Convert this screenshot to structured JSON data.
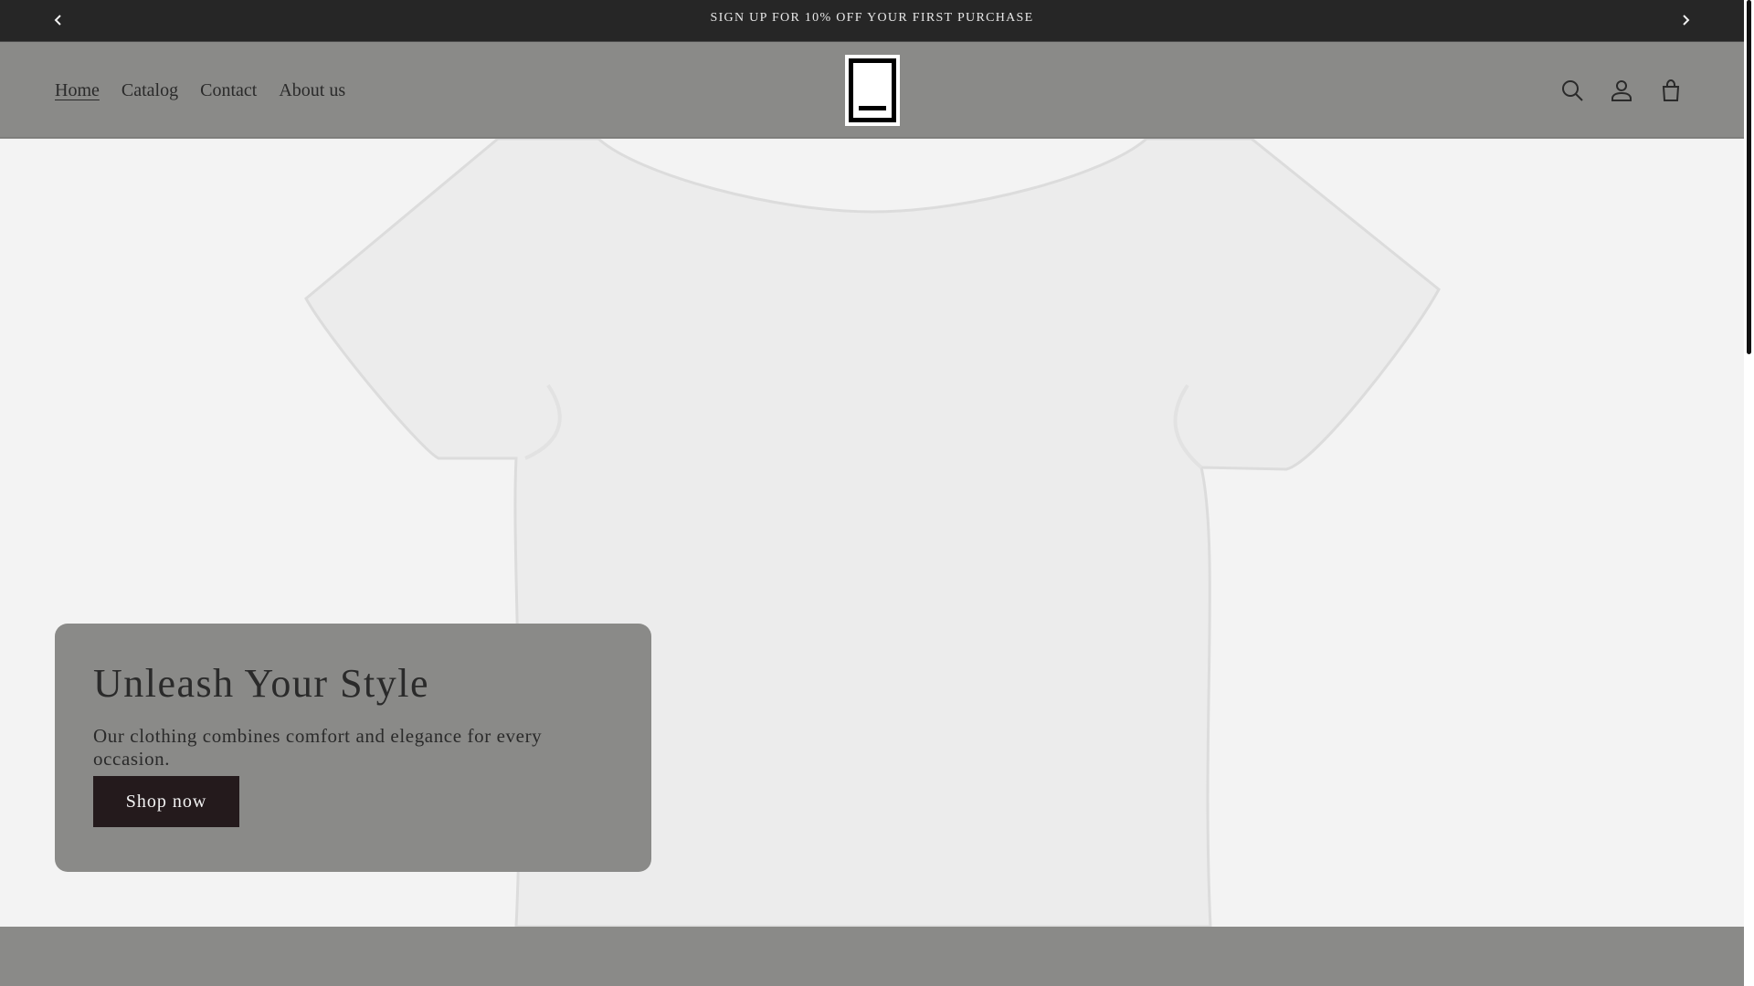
{
  "announcement": {
    "text": "SIGN UP FOR 10% OFF YOUR FIRST PURCHASE",
    "prev_icon": "chevron-left-icon",
    "next_icon": "chevron-right-icon"
  },
  "header": {
    "nav": [
      {
        "label": "Home",
        "active": true
      },
      {
        "label": "Catalog",
        "active": false
      },
      {
        "label": "Contact",
        "active": false
      },
      {
        "label": "About us",
        "active": false
      }
    ],
    "icons": [
      "search-icon",
      "account-icon",
      "cart-icon"
    ]
  },
  "hero": {
    "title": "Unleash Your Style",
    "text": "Our clothing combines comfort and elegance for every occasion.",
    "button_label": "Shop now"
  },
  "colors": {
    "announcement_bg": "#262626",
    "header_bg": "#8a8a88",
    "button_bg": "#241a1c",
    "text": "#2a2a2a"
  }
}
